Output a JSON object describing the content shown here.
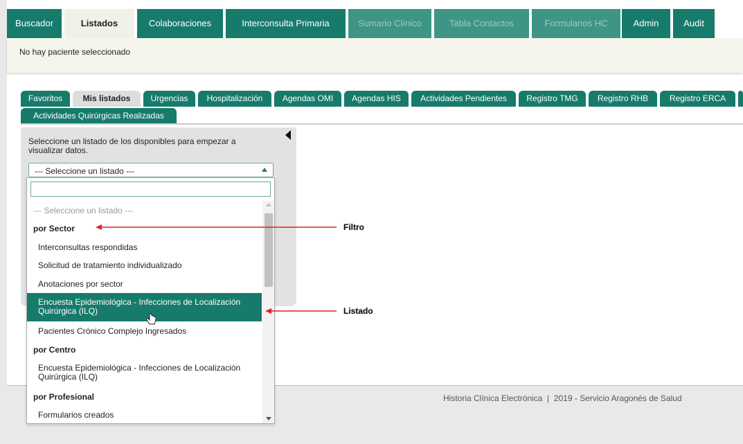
{
  "top_tabs": [
    {
      "label": "Buscador",
      "state": "normal"
    },
    {
      "label": "Listados",
      "state": "active"
    },
    {
      "label": "Colaboraciones",
      "state": "normal"
    },
    {
      "label": "Interconsulta Primaria",
      "state": "normal"
    },
    {
      "label": "Sumario Clínico",
      "state": "disabled"
    },
    {
      "label": "Tabla Contactos",
      "state": "disabled"
    },
    {
      "label": "Formularios HC",
      "state": "disabled"
    },
    {
      "label": "Admin",
      "state": "normal"
    },
    {
      "label": "Audit",
      "state": "normal"
    }
  ],
  "patient": {
    "status": "No hay paciente seleccionado"
  },
  "sub_tabs": [
    {
      "label": "Favoritos",
      "active": false
    },
    {
      "label": "Mis listados",
      "active": true
    },
    {
      "label": "Urgencias",
      "active": false
    },
    {
      "label": "Hospitalización",
      "active": false
    },
    {
      "label": "Agendas OMI",
      "active": false
    },
    {
      "label": "Agendas HIS",
      "active": false
    },
    {
      "label": "Actividades Pendientes",
      "active": false
    },
    {
      "label": "Registro TMG",
      "active": false
    },
    {
      "label": "Registro RHB",
      "active": false
    },
    {
      "label": "Registro ERCA",
      "active": false
    },
    {
      "label": "Actividades Quirúrgicas Realizadas",
      "active": false
    }
  ],
  "panel": {
    "hint": "Seleccione un listado de los disponibles para empezar a visualizar datos.",
    "select": {
      "value": "--- Seleccione un listado ---"
    }
  },
  "dropdown": {
    "search_value": "",
    "options": [
      {
        "label": "--- Seleccione un listado ---",
        "kind": "placeholder"
      },
      {
        "label": "por Sector",
        "kind": "group"
      },
      {
        "label": "Interconsultas respondidas",
        "kind": "option"
      },
      {
        "label": "Solicitud de tratamiento individualizado",
        "kind": "option"
      },
      {
        "label": "Anotaciones por sector",
        "kind": "option"
      },
      {
        "label": "Encuesta Epidemiológica - Infecciones de Localización Quirúrgica (ILQ)",
        "kind": "option",
        "highlighted": true
      },
      {
        "label": "Pacientes Crónico Complejo Ingresados",
        "kind": "option"
      },
      {
        "label": "por Centro",
        "kind": "group"
      },
      {
        "label": "Encuesta Epidemiológica - Infecciones de Localización Quirúrgica (ILQ)",
        "kind": "option"
      },
      {
        "label": "por Profesional",
        "kind": "group"
      },
      {
        "label": "Formularios creados",
        "kind": "option"
      }
    ]
  },
  "annotations": {
    "filtro": "Filtro",
    "listado": "Listado"
  },
  "footer": {
    "text": "Historia Clínica Electrónica  |  2019 - Servicio Aragonés de Salud"
  },
  "colors": {
    "primary": "#177b6b",
    "annotation_arrow": "#e02020"
  }
}
